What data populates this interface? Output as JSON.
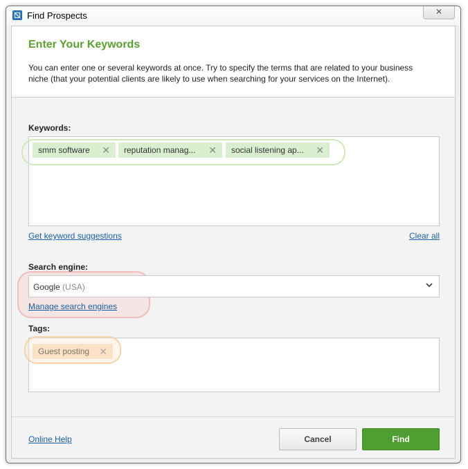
{
  "window": {
    "title": "Find Prospects",
    "close_label": "✕"
  },
  "header": {
    "heading": "Enter Your Keywords",
    "description": "You can enter one or several keywords at once. Try to specify the terms that are related to your business niche (that your potential clients are likely to use when searching for your services on the Internet)."
  },
  "keywords": {
    "label": "Keywords:",
    "items": [
      {
        "text": "smm software",
        "remove": "✕"
      },
      {
        "text": "reputation manag...",
        "remove": "✕"
      },
      {
        "text": "social listening ap...",
        "remove": "✕"
      }
    ],
    "suggestions_link": "Get keyword suggestions",
    "clear_link": "Clear all"
  },
  "search_engine": {
    "label": "Search engine:",
    "selected": "Google",
    "selected_region": "(USA)",
    "manage_link": "Manage search engines"
  },
  "tags": {
    "label": "Tags:",
    "items": [
      {
        "text": "Guest posting",
        "remove": "✕"
      }
    ]
  },
  "footer": {
    "help_link": "Online Help",
    "cancel_label": "Cancel",
    "find_label": "Find"
  },
  "colors": {
    "accent_green": "#5ba22f",
    "find_button": "#4f9e31",
    "keyword_tag": "#d9efcf",
    "tag_chip": "#fbe0c4",
    "link": "#1a5fa8"
  },
  "icons": {
    "app": "find-prospects-app-icon",
    "close": "close-icon",
    "dropdown": "chevron-down-icon",
    "remove": "remove-x-icon"
  }
}
